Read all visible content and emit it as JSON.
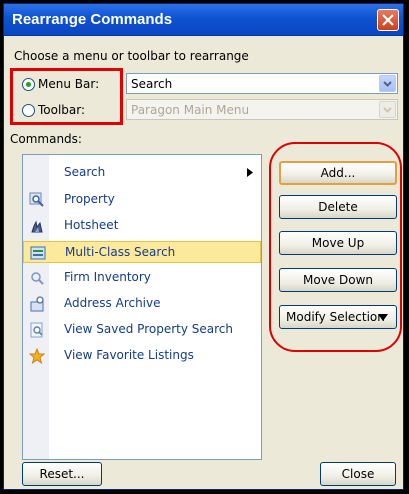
{
  "window": {
    "title": "Rearrange Commands"
  },
  "prompt": "Choose a menu or toolbar to rearrange",
  "menu_bar": {
    "label": "Menu Bar:",
    "selected": true,
    "value": "Search"
  },
  "toolbar": {
    "label": "Toolbar:",
    "selected": false,
    "value": "Paragon Main Menu"
  },
  "commands_label": "Commands:",
  "commands": [
    {
      "label": "Search",
      "icon": "none",
      "submenu": true
    },
    {
      "label": "Property",
      "icon": "magnifier-icon"
    },
    {
      "label": "Hotsheet",
      "icon": "fire-icon"
    },
    {
      "label": "Multi-Class Search",
      "icon": "search-list-icon",
      "selected": true
    },
    {
      "label": "Firm Inventory",
      "icon": "magnifier-icon"
    },
    {
      "label": "Address Archive",
      "icon": "address-icon"
    },
    {
      "label": "View Saved Property Search",
      "icon": "saved-search-icon"
    },
    {
      "label": "View Favorite Listings",
      "icon": "star-icon"
    }
  ],
  "buttons": {
    "add": "Add...",
    "delete": "Delete",
    "move_up": "Move Up",
    "move_down": "Move Down",
    "modify_selection": "Modify Selection",
    "reset": "Reset...",
    "close": "Close"
  },
  "colors": {
    "title_bar": "#0a46c2",
    "dialog_bg": "#ece9d8",
    "highlight": "#e00000",
    "selected_item": "#fde99a"
  }
}
